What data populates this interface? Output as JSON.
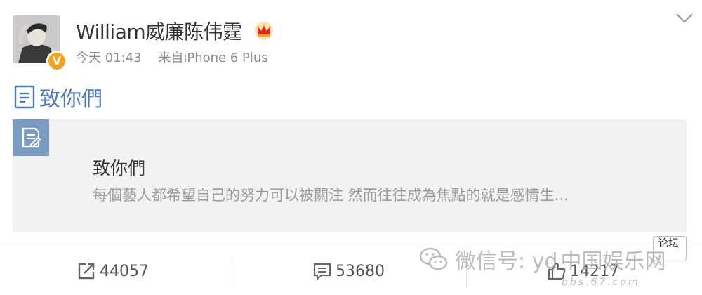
{
  "author": {
    "name": "William威廉陈伟霆",
    "verified_label": "V",
    "crown_icon": "crown-icon",
    "badge_color": "#f4a31a"
  },
  "meta": {
    "time": "今天 01:43",
    "source": "来自iPhone 6 Plus"
  },
  "post": {
    "title": "致你們"
  },
  "article_card": {
    "title": "致你們",
    "excerpt": "每個藝人都希望自己的努力可以被關注 然而往往成為焦點的就是感情生...",
    "icon": "article-doc-icon",
    "icon_color": "#7b9cc2"
  },
  "actions": {
    "repost_count": "44057",
    "comment_count": "53680",
    "like_count": "14217"
  },
  "watermark": {
    "wechat_label": "微信号: yd",
    "site_label": "中国娱乐网",
    "url": "bbs.67.com",
    "forum_label": "论坛"
  },
  "colors": {
    "link": "#4e7ab5",
    "meta_text": "#8c8c8c",
    "card_bg": "#f2f2f2"
  }
}
